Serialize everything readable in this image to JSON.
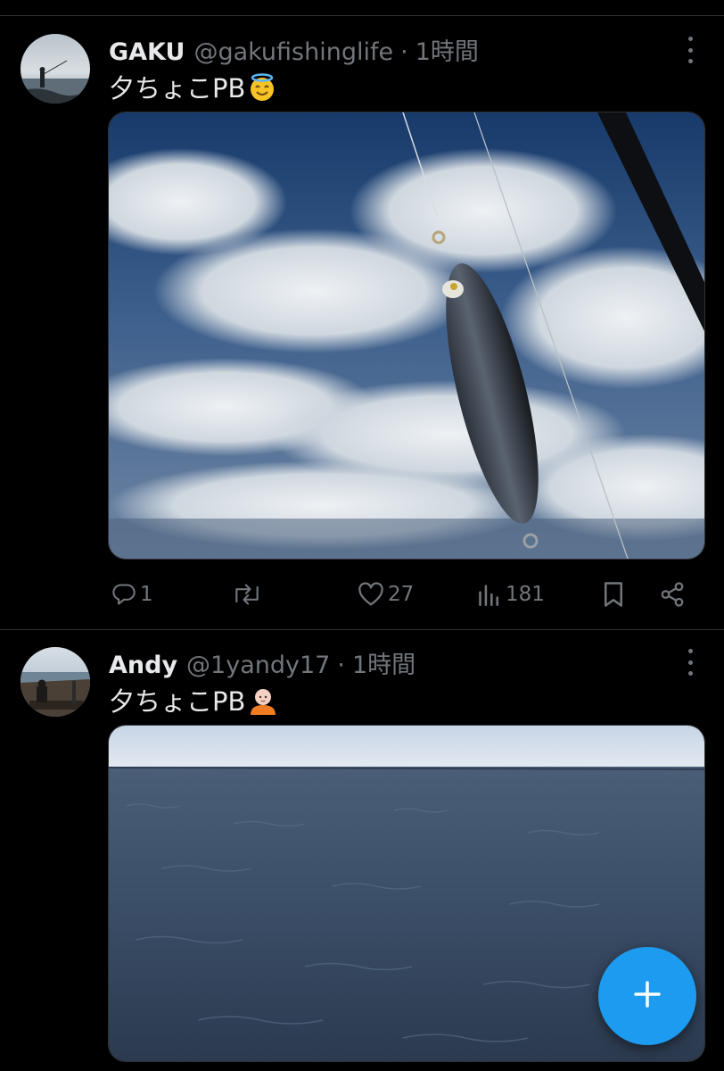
{
  "tweets": [
    {
      "name": "GAKU",
      "handle": "@gakufishinglife",
      "sep": "·",
      "time": "1時間",
      "text": "夕ちょこPB",
      "emoji_icon": "smiling-face-with-halo",
      "image_alt": "fishing lure hanging from rod against cloudy sky",
      "stats": {
        "replies": "1",
        "retweets": "",
        "likes": "27",
        "views": "181"
      }
    },
    {
      "name": "Andy",
      "handle": "@1yandy17",
      "sep": "·",
      "time": "1時間",
      "text": "夕ちょこPB",
      "emoji_icon": "bald-person",
      "image_alt": "open sea under cloudy sky"
    }
  ],
  "icons": {
    "reply": "reply-icon",
    "retweet": "retweet-icon",
    "like": "heart-icon",
    "views": "views-icon",
    "bookmark": "bookmark-icon",
    "share": "share-icon",
    "more": "more-icon",
    "compose": "plus-icon"
  },
  "colors": {
    "background": "#000000",
    "text": "#e7e9ea",
    "muted": "#71767b",
    "divider": "#2f3336",
    "accent": "#1d9bf0"
  }
}
